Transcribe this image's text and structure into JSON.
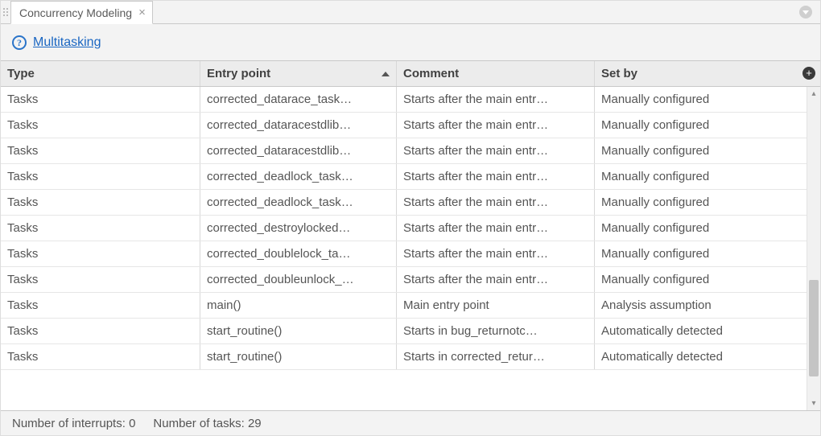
{
  "tab": {
    "title": "Concurrency Modeling"
  },
  "toolbar": {
    "help_link": "Multitasking"
  },
  "table": {
    "columns": {
      "type": "Type",
      "entry": "Entry point",
      "comment": "Comment",
      "setby": "Set by"
    },
    "sorted_by": "entry",
    "sort_dir": "asc",
    "rows": [
      {
        "type": "Tasks",
        "entry": "corrected_datarace_task…",
        "comment": "Starts after the main entr…",
        "setby": "Manually configured"
      },
      {
        "type": "Tasks",
        "entry": "corrected_dataracestdlib…",
        "comment": "Starts after the main entr…",
        "setby": "Manually configured"
      },
      {
        "type": "Tasks",
        "entry": "corrected_dataracestdlib…",
        "comment": "Starts after the main entr…",
        "setby": "Manually configured"
      },
      {
        "type": "Tasks",
        "entry": "corrected_deadlock_task…",
        "comment": "Starts after the main entr…",
        "setby": "Manually configured"
      },
      {
        "type": "Tasks",
        "entry": "corrected_deadlock_task…",
        "comment": "Starts after the main entr…",
        "setby": "Manually configured"
      },
      {
        "type": "Tasks",
        "entry": "corrected_destroylocked…",
        "comment": "Starts after the main entr…",
        "setby": "Manually configured"
      },
      {
        "type": "Tasks",
        "entry": "corrected_doublelock_ta…",
        "comment": "Starts after the main entr…",
        "setby": "Manually configured"
      },
      {
        "type": "Tasks",
        "entry": "corrected_doubleunlock_…",
        "comment": "Starts after the main entr…",
        "setby": "Manually configured"
      },
      {
        "type": "Tasks",
        "entry": "main()",
        "comment": "Main entry point",
        "setby": "Analysis assumption"
      },
      {
        "type": "Tasks",
        "entry": "start_routine()",
        "comment": "Starts in bug_returnotc…",
        "setby": "Automatically detected"
      },
      {
        "type": "Tasks",
        "entry": "start_routine()",
        "comment": "Starts in corrected_retur…",
        "setby": "Automatically detected"
      }
    ]
  },
  "footer": {
    "interrupts_label": "Number of interrupts:",
    "interrupts_value": "0",
    "tasks_label": "Number of tasks:",
    "tasks_value": "29"
  }
}
